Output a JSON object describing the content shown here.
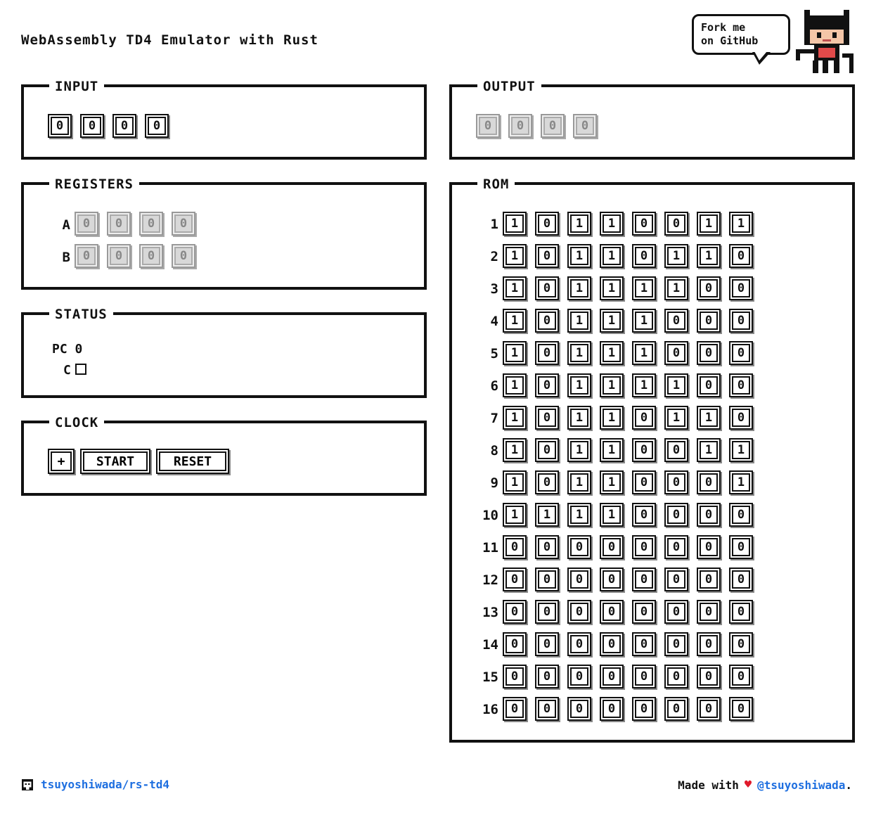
{
  "title": "WebAssembly TD4 Emulator with Rust",
  "fork_ribbon": {
    "line1": "Fork me",
    "line2": "on GitHub"
  },
  "input": {
    "legend": "INPUT",
    "bits": [
      "0",
      "0",
      "0",
      "0"
    ]
  },
  "output": {
    "legend": "OUTPUT",
    "bits": [
      "0",
      "0",
      "0",
      "0"
    ]
  },
  "registers": {
    "legend": "REGISTERS",
    "a_label": "A",
    "a_bits": [
      "0",
      "0",
      "0",
      "0"
    ],
    "b_label": "B",
    "b_bits": [
      "0",
      "0",
      "0",
      "0"
    ]
  },
  "status": {
    "legend": "STATUS",
    "pc_label": "PC",
    "pc_value": "0",
    "c_label": "C",
    "carry": false
  },
  "clock": {
    "legend": "CLOCK",
    "step_label": "+",
    "start_label": "START",
    "reset_label": "RESET"
  },
  "rom": {
    "legend": "ROM",
    "rows": [
      {
        "label": "1",
        "bits": [
          "1",
          "0",
          "1",
          "1",
          "0",
          "0",
          "1",
          "1"
        ]
      },
      {
        "label": "2",
        "bits": [
          "1",
          "0",
          "1",
          "1",
          "0",
          "1",
          "1",
          "0"
        ]
      },
      {
        "label": "3",
        "bits": [
          "1",
          "0",
          "1",
          "1",
          "1",
          "1",
          "0",
          "0"
        ]
      },
      {
        "label": "4",
        "bits": [
          "1",
          "0",
          "1",
          "1",
          "1",
          "0",
          "0",
          "0"
        ]
      },
      {
        "label": "5",
        "bits": [
          "1",
          "0",
          "1",
          "1",
          "1",
          "0",
          "0",
          "0"
        ]
      },
      {
        "label": "6",
        "bits": [
          "1",
          "0",
          "1",
          "1",
          "1",
          "1",
          "0",
          "0"
        ]
      },
      {
        "label": "7",
        "bits": [
          "1",
          "0",
          "1",
          "1",
          "0",
          "1",
          "1",
          "0"
        ]
      },
      {
        "label": "8",
        "bits": [
          "1",
          "0",
          "1",
          "1",
          "0",
          "0",
          "1",
          "1"
        ]
      },
      {
        "label": "9",
        "bits": [
          "1",
          "0",
          "1",
          "1",
          "0",
          "0",
          "0",
          "1"
        ]
      },
      {
        "label": "10",
        "bits": [
          "1",
          "1",
          "1",
          "1",
          "0",
          "0",
          "0",
          "0"
        ]
      },
      {
        "label": "11",
        "bits": [
          "0",
          "0",
          "0",
          "0",
          "0",
          "0",
          "0",
          "0"
        ]
      },
      {
        "label": "12",
        "bits": [
          "0",
          "0",
          "0",
          "0",
          "0",
          "0",
          "0",
          "0"
        ]
      },
      {
        "label": "13",
        "bits": [
          "0",
          "0",
          "0",
          "0",
          "0",
          "0",
          "0",
          "0"
        ]
      },
      {
        "label": "14",
        "bits": [
          "0",
          "0",
          "0",
          "0",
          "0",
          "0",
          "0",
          "0"
        ]
      },
      {
        "label": "15",
        "bits": [
          "0",
          "0",
          "0",
          "0",
          "0",
          "0",
          "0",
          "0"
        ]
      },
      {
        "label": "16",
        "bits": [
          "0",
          "0",
          "0",
          "0",
          "0",
          "0",
          "0",
          "0"
        ]
      }
    ]
  },
  "footer": {
    "repo_icon": "github-icon",
    "repo_link": "tsuyoshiwada/rs-td4",
    "made_with": "Made with",
    "heart_icon": "heart-icon",
    "heart": "♥",
    "author_link": "@tsuyoshiwada",
    "trailing": "."
  },
  "colors": {
    "link": "#1e6fe0",
    "heart": "#e0192b",
    "border": "#111111",
    "disabled_bit": "#d8d8d8"
  }
}
